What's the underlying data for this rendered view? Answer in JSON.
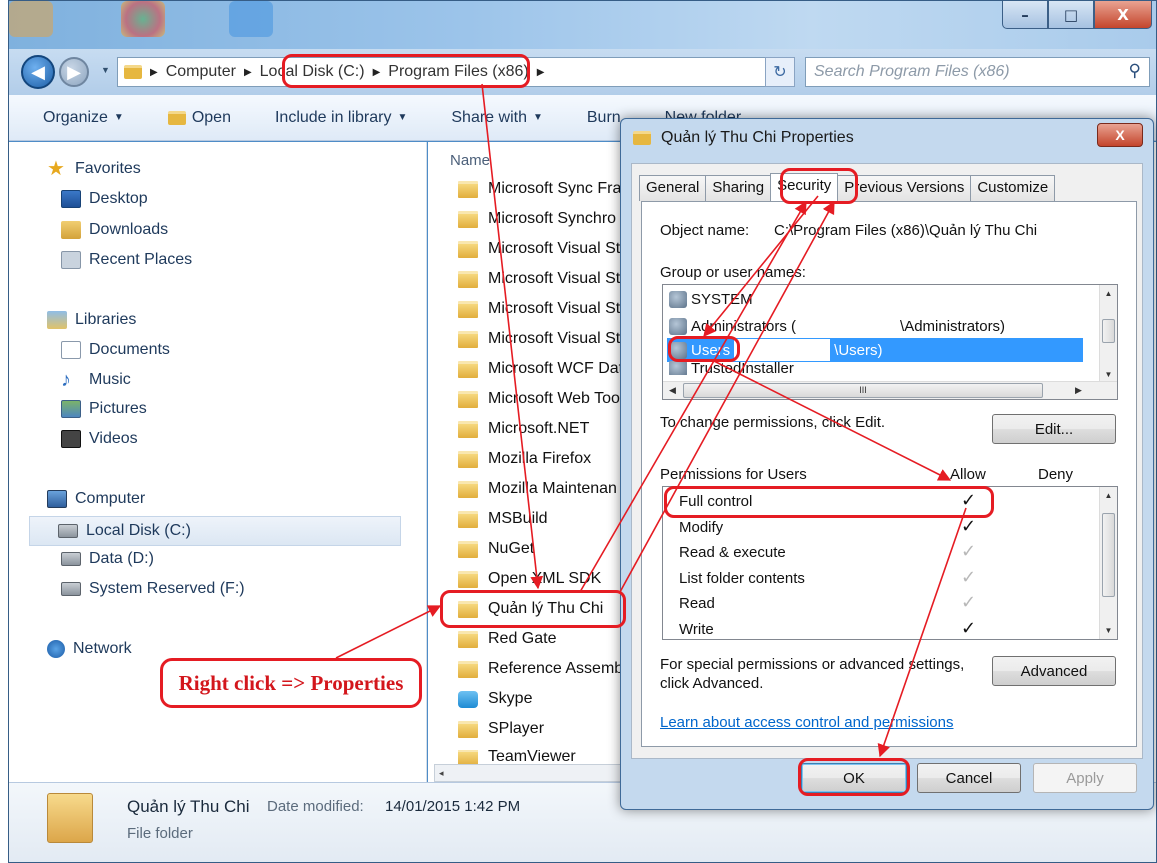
{
  "window": {
    "minimize_glyph": "–",
    "maximize_glyph": "□",
    "close_glyph": "X"
  },
  "address_bar": {
    "crumbs": [
      "Computer",
      "Local Disk (C:)",
      "Program Files (x86)"
    ],
    "separator": "▶",
    "dropdown_glyph": "▼",
    "refresh_glyph": "↻",
    "search_placeholder": "Search Program Files (x86)",
    "search_glyph": "⚲"
  },
  "toolbar": {
    "organize": "Organize",
    "open": "Open",
    "include_in_library": "Include in library",
    "share_with": "Share with",
    "burn": "Burn",
    "new_folder": "New folder",
    "caret": "▼"
  },
  "nav": {
    "favorites": "Favorites",
    "desktop": "Desktop",
    "downloads": "Downloads",
    "recent_places": "Recent Places",
    "libraries": "Libraries",
    "documents": "Documents",
    "music": "Music",
    "pictures": "Pictures",
    "videos": "Videos",
    "computer": "Computer",
    "local_disk": "Local Disk (C:)",
    "data": "Data (D:)",
    "system_reserved": "System Reserved (F:)",
    "network": "Network"
  },
  "files": {
    "column_name": "Name",
    "items": [
      "Microsoft Sync Fra",
      "Microsoft Synchro",
      "Microsoft Visual St",
      "Microsoft Visual St",
      "Microsoft Visual St",
      "Microsoft Visual St",
      "Microsoft WCF Dat",
      "Microsoft Web Too",
      "Microsoft.NET",
      "Mozilla Firefox",
      "Mozilla Maintenan",
      "MSBuild",
      "NuGet",
      "Open XML SDK",
      "Quản lý Thu Chi",
      "Red Gate",
      "Reference Assembl",
      "Skype",
      "SPlayer",
      "TeamViewer"
    ],
    "scroll_left": "◂"
  },
  "details": {
    "name": "Quản lý Thu Chi",
    "date_modified_label": "Date modified:",
    "date_modified": "14/01/2015 1:42 PM",
    "type": "File folder"
  },
  "dialog": {
    "title": "Quản lý Thu Chi Properties",
    "close": "X",
    "tabs": [
      "General",
      "Sharing",
      "Security",
      "Previous Versions",
      "Customize"
    ],
    "object_name_label": "Object name:",
    "object_name": "C:\\Program Files (x86)\\Quản lý Thu Chi",
    "group_label": "Group or user names:",
    "users": [
      {
        "prefix": "SYSTEM",
        "suffix": ""
      },
      {
        "prefix": "Administrators (",
        "suffix": "\\Administrators)"
      },
      {
        "prefix": "Users",
        "suffix": "\\Users)"
      },
      {
        "prefix": "TrustedInstaller",
        "suffix": ""
      }
    ],
    "users_hscroll_thumb": "III",
    "change_permissions_text": "To change permissions, click Edit.",
    "edit_button": "Edit...",
    "permissions_for": "Permissions for Users",
    "allow": "Allow",
    "deny": "Deny",
    "permissions": [
      {
        "name": "Full control",
        "allow": "checked"
      },
      {
        "name": "Modify",
        "allow": "checked"
      },
      {
        "name": "Read & execute",
        "allow": "inherited"
      },
      {
        "name": "List folder contents",
        "allow": "inherited"
      },
      {
        "name": "Read",
        "allow": "inherited"
      },
      {
        "name": "Write",
        "allow": "checked"
      }
    ],
    "check_glyph": "✓",
    "special_text_line1": "For special permissions or advanced settings,",
    "special_text_line2": "click Advanced.",
    "advanced_button": "Advanced",
    "learn_link": "Learn about access control and permissions",
    "ok_button": "OK",
    "cancel_button": "Cancel",
    "apply_button": "Apply"
  },
  "annotation": {
    "callout": "Right click => Properties",
    "color": "#e51c23"
  }
}
